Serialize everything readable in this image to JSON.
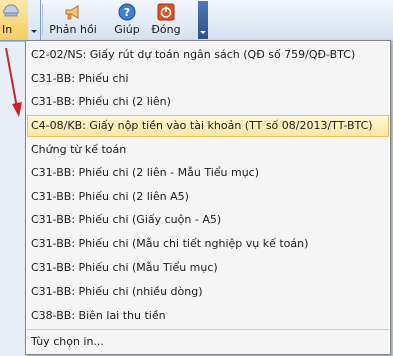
{
  "toolbar": {
    "print_label": "In",
    "feedback_label": "Phản hồi",
    "help_label": "Giúp",
    "close_label": "Đóng"
  },
  "menu": {
    "items": [
      "C2-02/NS: Giấy rút dự toán ngân sách (QĐ số 759/QĐ-BTC)",
      "C31-BB: Phiếu chi",
      "C31-BB: Phiếu chi (2 liên)",
      "C4-08/KB: Giấy nộp tiền vào tài khoản (TT số 08/2013/TT-BTC)",
      "Chứng từ kế toán",
      "C31-BB: Phiếu chi (2 liên - Mẫu Tiểu mục)",
      "C31-BB: Phiếu chi (2 liên A5)",
      "C31-BB: Phiếu chi (Giấy cuộn - A5)",
      "C31-BB: Phiếu chi (Mẫu chi tiết nghiệp vụ kế toán)",
      "C31-BB: Phiếu chi (Mẫu Tiểu mục)",
      "C31-BB: Phiếu chi (nhiều dòng)",
      "C38-BB: Biên lai thu tiền",
      "Tùy chọn in..."
    ]
  },
  "colors": {
    "highlight_bg": "#ffe7a2",
    "highlight_border": "#e5c365",
    "annotation_arrow": "#d42020"
  }
}
